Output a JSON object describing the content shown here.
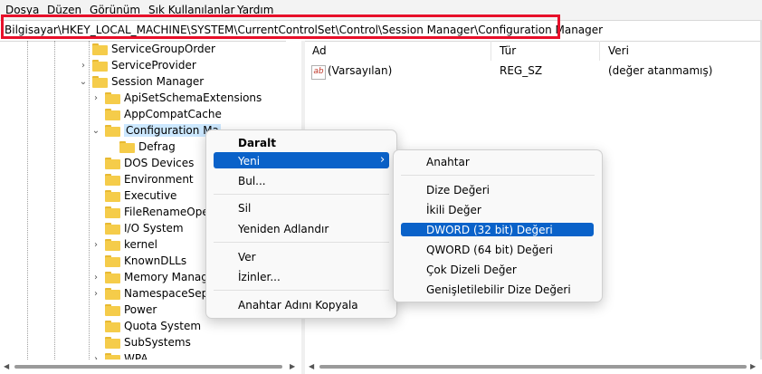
{
  "menubar": {
    "items": [
      {
        "pre": "D",
        "rest": "osya"
      },
      {
        "pre": "D",
        "rest": "üzen"
      },
      {
        "pre": "G",
        "rest": "örünüm"
      },
      {
        "pre": "S",
        "rest": "ık Kullanılanlar"
      },
      {
        "pre": "Y",
        "rest": "ardım"
      }
    ]
  },
  "address": {
    "path": "Bilgisayar\\HKEY_LOCAL_MACHINE\\SYSTEM\\CurrentControlSet\\Control\\Session Manager\\Configuration Manager"
  },
  "tree": {
    "nodes": [
      {
        "label": "ServiceGroupOrder",
        "chev": ""
      },
      {
        "label": "ServiceProvider",
        "chev": "›"
      },
      {
        "label": "Session Manager",
        "chev": "⌄"
      },
      {
        "label": "ApiSetSchemaExtensions",
        "chev": "›"
      },
      {
        "label": "AppCompatCache",
        "chev": ""
      },
      {
        "label": "Configuration Ma",
        "chev": "⌄"
      },
      {
        "label": "Defrag",
        "chev": ""
      },
      {
        "label": "DOS Devices",
        "chev": ""
      },
      {
        "label": "Environment",
        "chev": ""
      },
      {
        "label": "Executive",
        "chev": ""
      },
      {
        "label": "FileRenameOpera",
        "chev": ""
      },
      {
        "label": "I/O System",
        "chev": ""
      },
      {
        "label": "kernel",
        "chev": "›"
      },
      {
        "label": "KnownDLLs",
        "chev": ""
      },
      {
        "label": "Memory Manage",
        "chev": "›"
      },
      {
        "label": "NamespaceSepa",
        "chev": "›"
      },
      {
        "label": "Power",
        "chev": ""
      },
      {
        "label": "Quota System",
        "chev": ""
      },
      {
        "label": "SubSystems",
        "chev": ""
      },
      {
        "label": "WPA",
        "chev": "›"
      }
    ]
  },
  "list": {
    "columns": [
      "Ad",
      "Tür",
      "Veri"
    ],
    "rows": [
      {
        "name": "(Varsayılan)",
        "type": "REG_SZ",
        "data": "(değer atanmamış)",
        "icon": "ab"
      }
    ]
  },
  "context_menu": {
    "items": {
      "collapse": "Daralt",
      "new": "Yeni",
      "find": "Bul...",
      "delete": "Sil",
      "rename": "Yeniden Adlandır",
      "export": "Ver",
      "permissions": "İzinler...",
      "copy_key_name": "Anahtar Adını Kopyala"
    },
    "submenu_arrow": "›"
  },
  "submenu": {
    "items": {
      "key": "Anahtar",
      "string": "Dize Değeri",
      "binary": "İkili Değer",
      "dword": "DWORD (32 bit) Değeri",
      "qword": "QWORD (64 bit) Değeri",
      "multi_string": "Çok Dizeli Değer",
      "expandable_string": "Genişletilebilir Dize Değeri"
    }
  },
  "colors": {
    "highlight": "#0a62c9",
    "annotation_box": "#e8102a",
    "folder": "#f5cc4a",
    "tree_selection": "#cce8ff"
  }
}
